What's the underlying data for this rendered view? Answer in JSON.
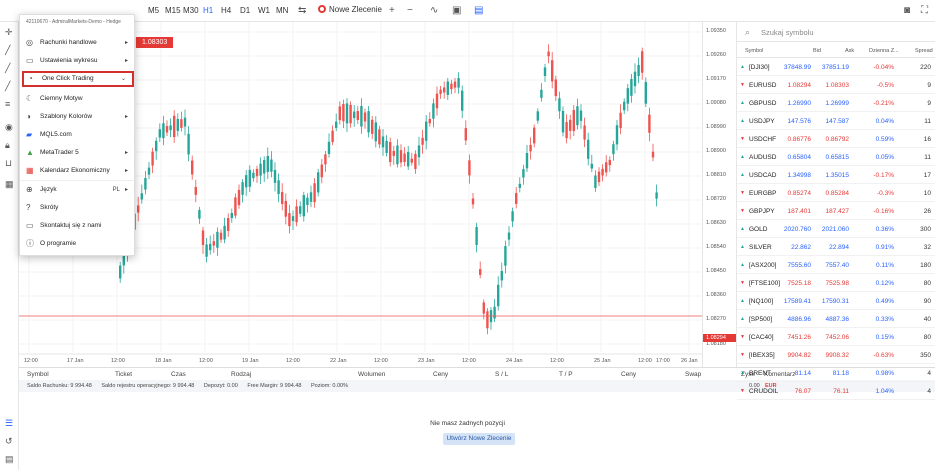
{
  "toolbar": {
    "timeframes": [
      "M5",
      "M15",
      "M30",
      "H1",
      "H4",
      "D1",
      "W1",
      "MN"
    ],
    "active_timeframe": "H1",
    "new_order_label": "Nowe Zlecenie"
  },
  "menu": {
    "account": "42110670 - AdmiralMarkets-Demo - Hedge",
    "items": [
      {
        "label": "Rachunki handlowe",
        "icon": "wallet-icon",
        "submenu": true
      },
      {
        "label": "Ustawienia wykresu",
        "icon": "chart-settings-icon",
        "submenu": true
      },
      {
        "label": "One Click Trading",
        "icon": "one-click-icon",
        "submenu": true,
        "highlighted": true
      },
      {
        "label": "Ciemny Motyw",
        "icon": "moon-icon"
      },
      {
        "label": "Szablony Kolorów",
        "icon": "palette-icon",
        "submenu": true
      },
      {
        "label": "MQL5.com",
        "icon": "mql5-icon"
      },
      {
        "label": "MetaTrader 5",
        "icon": "mt5-icon",
        "submenu": true
      },
      {
        "label": "Kalendarz Ekonomiczny",
        "icon": "calendar-icon",
        "submenu": true
      },
      {
        "label": "Język",
        "icon": "language-icon",
        "submenu": true,
        "value": "PL"
      },
      {
        "label": "Skróty",
        "icon": "help-icon"
      },
      {
        "label": "Skontaktuj się z nami",
        "icon": "chat-icon"
      },
      {
        "label": "O programie",
        "icon": "info-icon"
      }
    ]
  },
  "chart": {
    "price_tag": "1.08303",
    "current_price": "1.08294",
    "price_ticks": [
      "1.09350",
      "1.09260",
      "1.09170",
      "1.09080",
      "1.08990",
      "1.08900",
      "1.08810",
      "1.08720",
      "1.08630",
      "1.08540",
      "1.08450",
      "1.08360",
      "1.08270",
      "1.08180"
    ],
    "x_ticks": [
      "12:00",
      "17 Jan",
      "12:00",
      "18 Jan",
      "12:00",
      "19 Jan",
      "12:00",
      "22 Jan",
      "12:00",
      "23 Jan",
      "12:00",
      "24 Jan",
      "12:00",
      "25 Jan",
      "12:00",
      "17:00",
      "26 Jan"
    ],
    "colors": {
      "up": "#26a69a",
      "down": "#ef5350"
    }
  },
  "positions": {
    "headers": [
      "Symbol",
      "Ticket",
      "Czas",
      "Rodzaj",
      "Wolumen",
      "Ceny",
      "S / L",
      "T / P",
      "Ceny",
      "Swap",
      "Zysk",
      "Komentarz"
    ],
    "stats": [
      "Saldo Rachunku: 9 994.48",
      "Saldo rejestru operacyjnego: 9 994.48",
      "Depozyt: 0.00",
      "Free Margin: 9 994.48",
      "Poziom: 0.00%"
    ],
    "profit": "0.00",
    "currency": "EUR",
    "empty_message": "Nie masz żadnych pozycji",
    "new_position_button": "Utwórz Nowe Zlecenie"
  },
  "watchlist": {
    "search_placeholder": "Szukaj symbolu",
    "headers": {
      "symbol": "Symbol",
      "bid": "Bid",
      "ask": "Ask",
      "change": "Dzienna Z...",
      "spread": "Spread"
    },
    "rows": [
      {
        "symbol": "[DJI30]",
        "bid": "37848.99",
        "ask": "37851.19",
        "change": "-0.04%",
        "spread": "220",
        "dir": "up"
      },
      {
        "symbol": "EURUSD",
        "bid": "1.08294",
        "ask": "1.08303",
        "change": "-0.5%",
        "spread": "9",
        "dir": "down"
      },
      {
        "symbol": "GBPUSD",
        "bid": "1.26990",
        "ask": "1.26999",
        "change": "-0.21%",
        "spread": "9",
        "dir": "up"
      },
      {
        "symbol": "USDJPY",
        "bid": "147.576",
        "ask": "147.587",
        "change": "0.04%",
        "spread": "11",
        "dir": "up"
      },
      {
        "symbol": "USDCHF",
        "bid": "0.86776",
        "ask": "0.86792",
        "change": "0.59%",
        "spread": "16",
        "dir": "down"
      },
      {
        "symbol": "AUDUSD",
        "bid": "0.65804",
        "ask": "0.65815",
        "change": "0.05%",
        "spread": "11",
        "dir": "up"
      },
      {
        "symbol": "USDCAD",
        "bid": "1.34998",
        "ask": "1.35015",
        "change": "-0.17%",
        "spread": "17",
        "dir": "up"
      },
      {
        "symbol": "EURGBP",
        "bid": "0.85274",
        "ask": "0.85284",
        "change": "-0.3%",
        "spread": "10",
        "dir": "down"
      },
      {
        "symbol": "GBPJPY",
        "bid": "187.401",
        "ask": "187.427",
        "change": "-0.16%",
        "spread": "26",
        "dir": "down"
      },
      {
        "symbol": "GOLD",
        "bid": "2020.760",
        "ask": "2021.060",
        "change": "0.36%",
        "spread": "300",
        "dir": "up"
      },
      {
        "symbol": "SILVER",
        "bid": "22.862",
        "ask": "22.894",
        "change": "0.91%",
        "spread": "32",
        "dir": "up"
      },
      {
        "symbol": "[ASX200]",
        "bid": "7555.60",
        "ask": "7557.40",
        "change": "0.11%",
        "spread": "180",
        "dir": "up"
      },
      {
        "symbol": "[FTSE100]",
        "bid": "7525.18",
        "ask": "7525.98",
        "change": "0.12%",
        "spread": "80",
        "dir": "down"
      },
      {
        "symbol": "[NQ100]",
        "bid": "17589.41",
        "ask": "17590.31",
        "change": "0.49%",
        "spread": "90",
        "dir": "up"
      },
      {
        "symbol": "[SP500]",
        "bid": "4886.96",
        "ask": "4887.36",
        "change": "0.33%",
        "spread": "40",
        "dir": "up"
      },
      {
        "symbol": "[CAC40]",
        "bid": "7451.26",
        "ask": "7452.06",
        "change": "0.15%",
        "spread": "80",
        "dir": "down"
      },
      {
        "symbol": "[IBEX35]",
        "bid": "9904.82",
        "ask": "9908.32",
        "change": "-0.63%",
        "spread": "350",
        "dir": "down"
      },
      {
        "symbol": "BRENT",
        "bid": "81.14",
        "ask": "81.18",
        "change": "0.98%",
        "spread": "4",
        "dir": "up"
      },
      {
        "symbol": "CRUDOIL",
        "bid": "76.07",
        "ask": "76.11",
        "change": "1.04%",
        "spread": "4",
        "dir": "down"
      }
    ]
  }
}
